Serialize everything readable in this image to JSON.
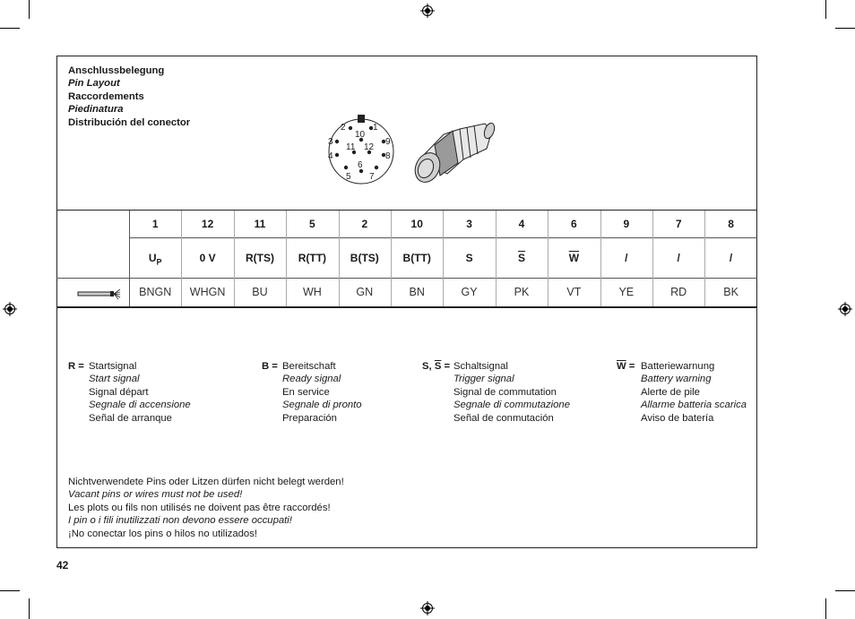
{
  "titles": [
    "Anschlussbelegung",
    "Pin Layout",
    "Raccordements",
    "Piedinatura",
    "Distribución del conector"
  ],
  "pin_face_labels": [
    "1",
    "2",
    "3",
    "4",
    "5",
    "6",
    "7",
    "8",
    "9",
    "10",
    "11",
    "12"
  ],
  "table": {
    "columns": [
      {
        "pin": "1",
        "signal": "U",
        "signal_sub": "P",
        "color": "BNGN",
        "overline": false
      },
      {
        "pin": "12",
        "signal": "0 V",
        "color": "WHGN",
        "overline": false
      },
      {
        "pin": "11",
        "signal": "R(TS)",
        "color": "BU",
        "overline": false
      },
      {
        "pin": "5",
        "signal": "R(TT)",
        "color": "WH",
        "overline": false
      },
      {
        "pin": "2",
        "signal": "B(TS)",
        "color": "GN",
        "overline": false
      },
      {
        "pin": "10",
        "signal": "B(TT)",
        "color": "BN",
        "overline": false
      },
      {
        "pin": "3",
        "signal": "S",
        "color": "GY",
        "overline": false
      },
      {
        "pin": "4",
        "signal": "S",
        "color": "PK",
        "overline": true
      },
      {
        "pin": "6",
        "signal": "W",
        "color": "VT",
        "overline": true
      },
      {
        "pin": "9",
        "signal": "/",
        "color": "YE",
        "overline": false
      },
      {
        "pin": "7",
        "signal": "/",
        "color": "RD",
        "overline": false
      },
      {
        "pin": "8",
        "signal": "/",
        "color": "BK",
        "overline": false
      }
    ],
    "cable_icon": "cable-icon"
  },
  "legend": [
    {
      "key": "R =",
      "lines": [
        "Startsignal",
        "Start signal",
        "Signal départ",
        "Segnale di accensione",
        "Señal de arranque"
      ]
    },
    {
      "key": "B =",
      "lines": [
        "Bereitschaft",
        "Ready signal",
        "En service",
        "Segnale di pronto",
        "Preparación"
      ]
    },
    {
      "key_a": "S, ",
      "key_b": "S",
      "key_c": " =",
      "lines": [
        "Schaltsignal",
        "Trigger signal",
        "Signal de commutation",
        "Segnale di commutazione",
        "Señal de conmutación"
      ]
    },
    {
      "key_b": "W",
      "key_c": " =",
      "lines": [
        "Batteriewarnung",
        "Battery warning",
        "Alerte de pile",
        "Allarme batteria scarica",
        "Aviso de batería"
      ]
    }
  ],
  "notes": [
    "Nichtverwendete Pins oder Litzen dürfen nicht belegt werden!",
    "Vacant pins or wires must not be used!",
    "Les plots ou fils non utilisés ne doivent pas être raccordés!",
    "I pin o i fili inutilizzati non devono essere occupati!",
    "¡No conectar los pins o hilos no utilizados!"
  ],
  "page_number": "42"
}
